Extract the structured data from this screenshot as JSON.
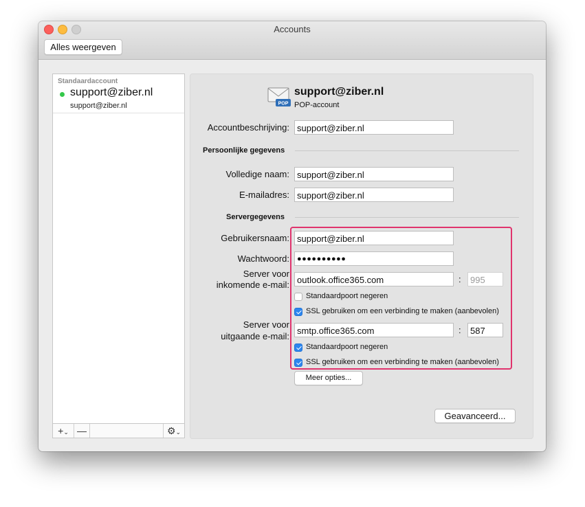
{
  "window": {
    "title": "Accounts",
    "show_all_label": "Alles weergeven"
  },
  "sidebar": {
    "header": "Standaardaccount",
    "accounts": [
      {
        "name": "support@ziber.nl",
        "email": "support@ziber.nl",
        "status_color": "#34c84a"
      }
    ],
    "add_label": "+",
    "add_menu_icon": "chevron-down-icon",
    "remove_label": "—",
    "gear_icon": "gear-icon"
  },
  "account": {
    "name": "support@ziber.nl",
    "type": "POP-account",
    "icon_badge": "POP",
    "description_label": "Accountbeschrijving:",
    "description_value": "support@ziber.nl"
  },
  "personal": {
    "heading": "Persoonlijke gegevens",
    "fullname_label": "Volledige naam:",
    "fullname_value": "support@ziber.nl",
    "email_label": "E-mailadres:",
    "email_value": "support@ziber.nl"
  },
  "server": {
    "heading": "Servergegevens",
    "username_label": "Gebruikersnaam:",
    "username_value": "support@ziber.nl",
    "password_label": "Wachtwoord:",
    "password_value": "●●●●●●●●●●",
    "incoming_label_1": "Server voor",
    "incoming_label_2": "inkomende e-mail:",
    "incoming_value": "outlook.office365.com",
    "incoming_port": "995",
    "incoming_override_label": "Standaardpoort negeren",
    "incoming_override_checked": false,
    "incoming_ssl_label": "SSL gebruiken om een verbinding te maken (aanbevolen)",
    "incoming_ssl_checked": true,
    "outgoing_label_1": "Server voor",
    "outgoing_label_2": "uitgaande e-mail:",
    "outgoing_value": "smtp.office365.com",
    "outgoing_port": "587",
    "outgoing_override_label": "Standaardpoort negeren",
    "outgoing_override_checked": true,
    "outgoing_ssl_label": "SSL gebruiken om een verbinding te maken (aanbevolen)",
    "outgoing_ssl_checked": true,
    "colon": ":",
    "more_options_label": "Meer opties..."
  },
  "advanced_label": "Geavanceerd...",
  "colors": {
    "highlight": "#e0336d",
    "checkbox_on": "#2d86ee"
  }
}
